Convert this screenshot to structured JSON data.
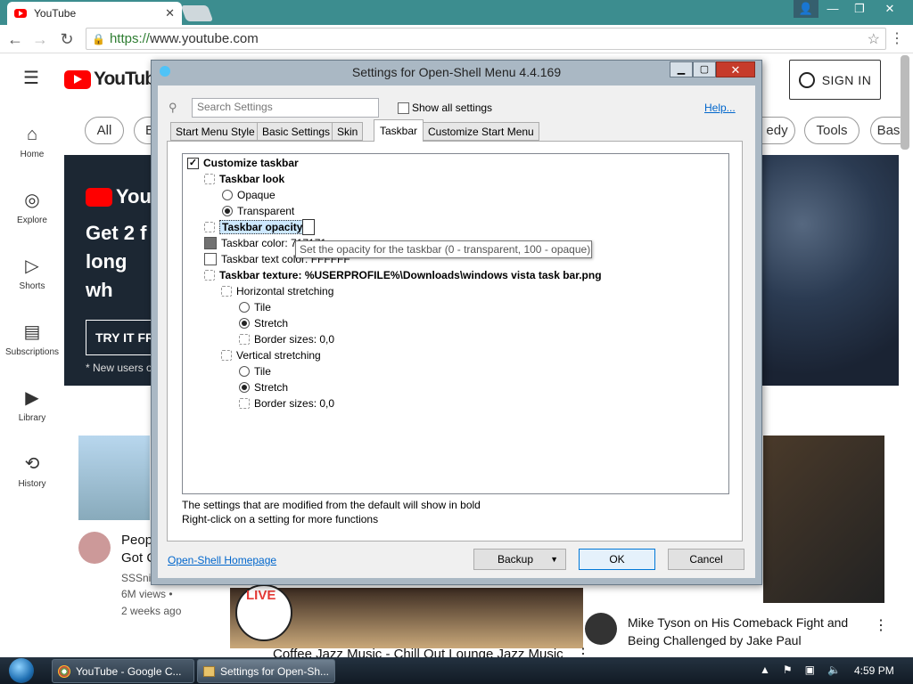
{
  "browser": {
    "tab_title": "YouTube",
    "url_scheme": "https://",
    "url_rest": "www.youtube.com"
  },
  "youtube": {
    "logo_text": "YouTube",
    "sign_in": "SIGN IN",
    "chips": [
      "All",
      "B",
      "edy",
      "Tools",
      "Bas"
    ],
    "sidebar": [
      {
        "label": "Home",
        "icon": "home-icon"
      },
      {
        "label": "Explore",
        "icon": "compass-icon"
      },
      {
        "label": "Shorts",
        "icon": "shorts-icon"
      },
      {
        "label": "Subscriptions",
        "icon": "subscriptions-icon"
      },
      {
        "label": "Library",
        "icon": "library-icon"
      },
      {
        "label": "History",
        "icon": "history-icon"
      }
    ],
    "banner": {
      "logo_text": "You",
      "headline": "Get 2 f long wh",
      "cta": "TRY IT FR",
      "note": "* New users o"
    },
    "videos": [
      {
        "title_line1": "Peop",
        "title_line2": "Got C",
        "channel": "SSSni",
        "views": "6M views •",
        "age": "2 weeks ago"
      },
      {
        "title": "Coffee Jazz Music - Chill Out Lounge Jazz Music",
        "badge": "LIVE"
      },
      {
        "title_line1": "Mike Tyson on His Comeback Fight and",
        "title_line2": "Being Challenged by Jake Paul"
      }
    ]
  },
  "dialog": {
    "title": "Settings for Open-Shell Menu 4.4.169",
    "search_placeholder": "Search Settings",
    "show_all": "Show all settings",
    "help": "Help...",
    "tabs": [
      "Start Menu Style",
      "Basic Settings",
      "Skin",
      "Taskbar",
      "Customize Start Menu"
    ],
    "active_tab": "Taskbar",
    "tree": {
      "customize_taskbar": "Customize taskbar",
      "taskbar_look": "Taskbar look",
      "opaque": "Opaque",
      "transparent": "Transparent",
      "taskbar_opacity": "Taskbar opacity",
      "taskbar_color": "Taskbar color: 717171",
      "taskbar_text_color": "Taskbar text color: FFFFFF",
      "taskbar_texture": "Taskbar texture: %USERPROFILE%\\Downloads\\windows vista task bar.png",
      "horizontal_stretching": "Horizontal stretching",
      "tile": "Tile",
      "stretch": "Stretch",
      "border_sizes": "Border sizes: 0,0",
      "vertical_stretching": "Vertical stretching"
    },
    "tooltip": "Set the opacity for the taskbar (0 - transparent, 100 - opaque)",
    "info_line1": "The settings that are modified from the default will show in bold",
    "info_line2": "Right-click on a setting for more functions",
    "homepage": "Open-Shell Homepage",
    "backup": "Backup",
    "ok": "OK",
    "cancel": "Cancel",
    "colors": {
      "taskbar_color": "#717171",
      "text_color": "#FFFFFF"
    }
  },
  "taskbar": {
    "items": [
      "YouTube - Google C...",
      "Settings for Open-Sh..."
    ],
    "clock": "4:59 PM"
  }
}
